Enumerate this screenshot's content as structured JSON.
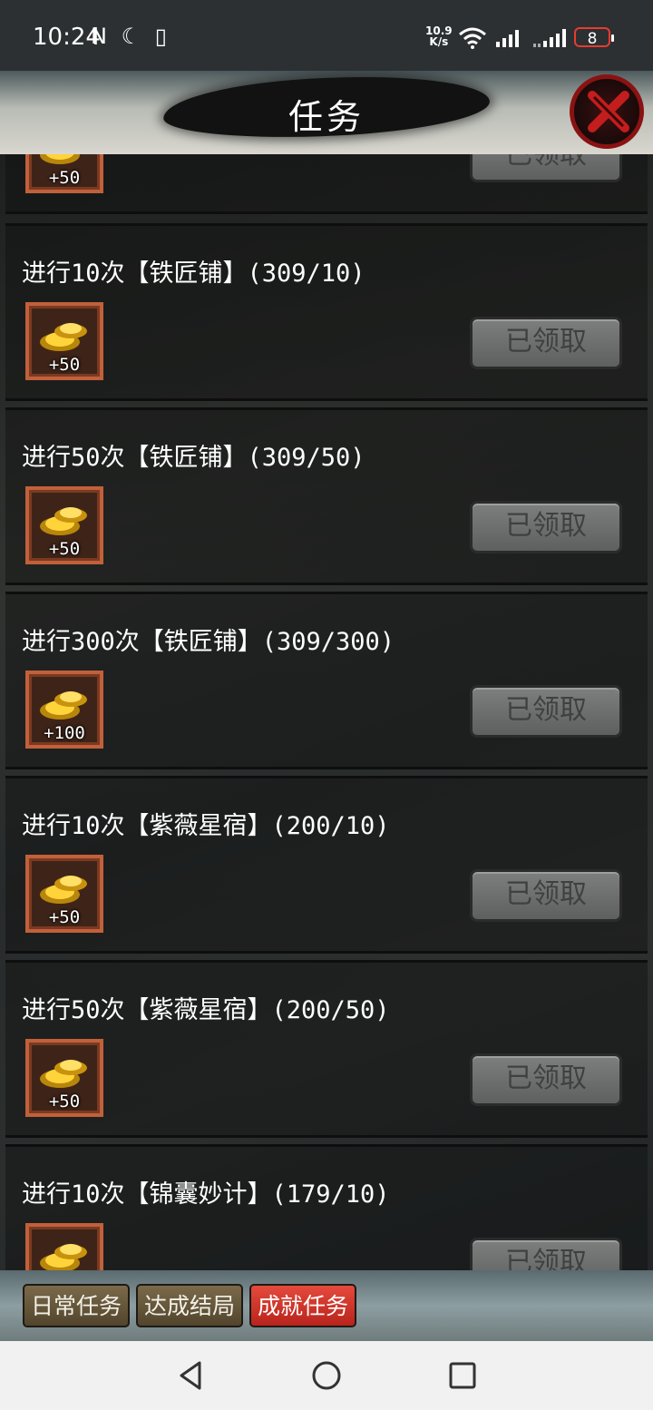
{
  "status_bar": {
    "time": "10:24",
    "left_icons": "N ☾ ▯",
    "net_speed_value": "10.9",
    "net_speed_unit": "K/s",
    "battery": "8"
  },
  "header": {
    "title": "任务"
  },
  "tasks": [
    {
      "title": "",
      "reward": "+50",
      "button": "已领取"
    },
    {
      "title": "进行10次【铁匠铺】(309/10)",
      "reward": "+50",
      "button": "已领取"
    },
    {
      "title": "进行50次【铁匠铺】(309/50)",
      "reward": "+50",
      "button": "已领取"
    },
    {
      "title": "进行300次【铁匠铺】(309/300)",
      "reward": "+100",
      "button": "已领取"
    },
    {
      "title": "进行10次【紫薇星宿】(200/10)",
      "reward": "+50",
      "button": "已领取"
    },
    {
      "title": "进行50次【紫薇星宿】(200/50)",
      "reward": "+50",
      "button": "已领取"
    },
    {
      "title": "进行10次【锦囊妙计】(179/10)",
      "reward": "",
      "button": "已领取"
    }
  ],
  "tabs": [
    {
      "label": "日常任务",
      "active": false
    },
    {
      "label": "达成结局",
      "active": false
    },
    {
      "label": "成就任务",
      "active": true
    }
  ],
  "colors": {
    "tab_active": "#d8352a",
    "reward_border": "#c2603a",
    "close_ring": "#8a1212"
  }
}
